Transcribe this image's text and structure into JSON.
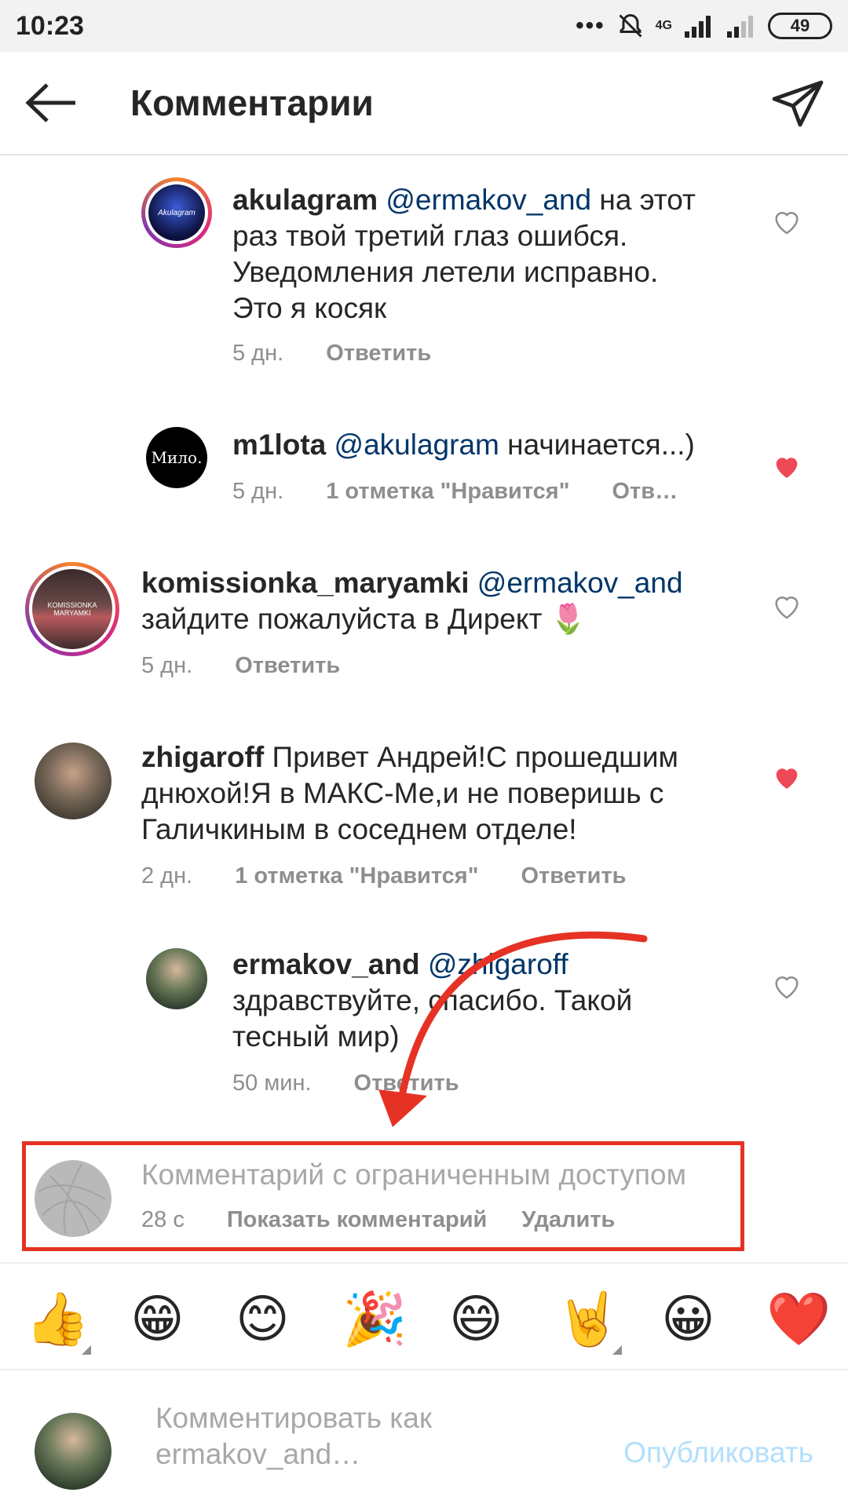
{
  "status_bar": {
    "time": "10:23",
    "dots": "•••",
    "network": "4G",
    "battery": "49"
  },
  "header": {
    "title": "Комментарии"
  },
  "comments": [
    {
      "user": "akulagram",
      "mention": "@ermakov_and",
      "text_lines": [
        "на этот",
        "раз твой третий глаз ошибся.",
        "Уведомления летели исправно.",
        "Это я косяк"
      ],
      "avatar_label": "Akulagram",
      "time": "5 дн.",
      "reply": "Ответить",
      "liked": false
    },
    {
      "user": "m1lota",
      "mention": "@akulagram",
      "text": "начинается...)",
      "avatar_label": "Мило.",
      "time": "5 дн.",
      "likes": "1 отметка \"Нравится\"",
      "reply": "Отв…",
      "liked": true
    },
    {
      "user": "komissionka_maryamki",
      "mention": "@ermakov_and",
      "text": "зайдите пожалуйста в Директ 🌷",
      "avatar_label": "KOMISSIONKA MARYAMKI",
      "time": "5 дн.",
      "reply": "Ответить",
      "liked": false
    },
    {
      "user": "zhigaroff",
      "text_first": "Привет Андрей!С прошедшим",
      "text_lines": [
        "днюхой!Я в МАКС-Ме,и не поверишь с",
        "Галичкиным в соседнем отделе!"
      ],
      "time": "2 дн.",
      "likes": "1 отметка \"Нравится\"",
      "reply": "Ответить",
      "liked": true
    },
    {
      "user": "ermakov_and",
      "mention": "@zhigaroff",
      "text_lines": [
        "здравствуйте, спасибо. Такой",
        "тесный мир)"
      ],
      "time": "50 мин.",
      "reply": "Ответить",
      "liked": false
    }
  ],
  "restricted": {
    "text": "Комментарий с ограниченным доступом",
    "time": "28 с",
    "show": "Показать комментарий",
    "delete": "Удалить"
  },
  "emoji_bar": [
    "👍",
    "😁",
    "😊",
    "🎉",
    "😄",
    "🤘",
    "😀",
    "❤️"
  ],
  "input": {
    "placeholder_line1": "Комментировать как",
    "placeholder_line2": "ermakov_and…",
    "publish": "Опубликовать"
  },
  "colors": {
    "accent_red": "#ed4956",
    "annotation_red": "#e53224",
    "mention_blue": "#003569",
    "publish_blue": "#b2dffc"
  }
}
